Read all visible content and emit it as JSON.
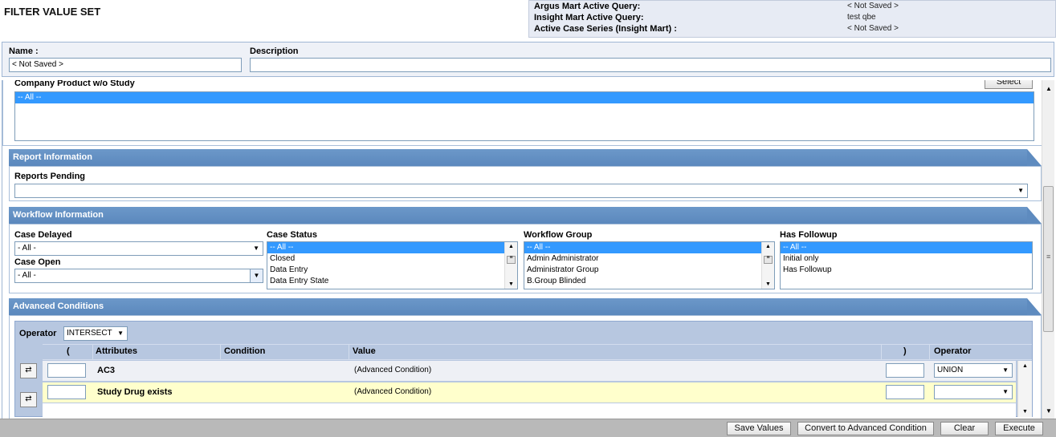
{
  "page": {
    "title": "FILTER VALUE SET"
  },
  "active_queries": [
    {
      "label": "Argus Mart Active Query:",
      "value": "< Not Saved >"
    },
    {
      "label": "Insight Mart Active Query:",
      "value": "test qbe"
    },
    {
      "label": "Active Case Series (Insight Mart) :",
      "value": "< Not Saved >"
    }
  ],
  "name_panel": {
    "name_label": "Name :",
    "name_value": "< Not Saved >",
    "description_label": "Description",
    "description_value": ""
  },
  "company_product": {
    "label": "Company Product w/o Study",
    "select_button": "Select",
    "items": [
      "-- All --"
    ]
  },
  "report_information": {
    "header": "Report Information",
    "reports_pending_label": "Reports Pending",
    "reports_pending_value": ""
  },
  "workflow_information": {
    "header": "Workflow Information",
    "case_delayed_label": "Case Delayed",
    "case_delayed_value": "- All -",
    "case_open_label": "Case Open",
    "case_open_value": "- All -",
    "case_status_label": "Case Status",
    "case_status_items": [
      "-- All --",
      "Closed",
      "Data Entry",
      "Data Entry State"
    ],
    "workflow_group_label": "Workflow Group",
    "workflow_group_items": [
      "-- All --",
      "Admin Administrator",
      "Administrator Group",
      "B.Group Blinded"
    ],
    "has_followup_label": "Has Followup",
    "has_followup_items": [
      "-- All --",
      "Initial only",
      "Has Followup"
    ]
  },
  "advanced_conditions": {
    "header": "Advanced Conditions",
    "operator_label": "Operator",
    "operator_value": "INTERSECT",
    "columns": {
      "open_paren": "(",
      "attributes": "Attributes",
      "condition": "Condition",
      "value": "Value",
      "close_paren": ")",
      "operator": "Operator"
    },
    "rows": [
      {
        "attribute": "AC3",
        "condition": "",
        "value": "(Advanced Condition)",
        "operator": "UNION"
      },
      {
        "attribute": "Study Drug exists",
        "condition": "",
        "value": "(Advanced Condition)",
        "operator": ""
      }
    ]
  },
  "footer": {
    "save_values": "Save Values",
    "convert": "Convert to Advanced Condition",
    "clear": "Clear",
    "execute": "Execute"
  },
  "colors": {
    "section_header": "#5e8bbf",
    "selected": "#3399ff",
    "adv_panel": "#b7c7e0",
    "highlight_row": "#ffffcc"
  }
}
